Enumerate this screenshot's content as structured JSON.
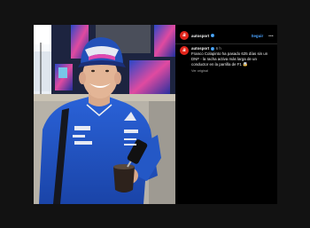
{
  "post": {
    "username": "autosport",
    "follow_label": "Seguir",
    "more_label": "•••",
    "avatar_letter": "a",
    "time_ago": "6 h",
    "caption": "Franco Colapinto ha pasado 625 días sin un DNF - la racha activa más larga de un conductor en la parrilla de F1",
    "caption_emoji": "🤯",
    "see_original": "Ver original"
  },
  "photo": {
    "cap_logo": "A",
    "team_mark": "A",
    "sponsor_1": "eni",
    "sponsor_2": "MSC",
    "sponsor_3": "Boeing"
  },
  "colors": {
    "accent": "#4aa3ff",
    "brand": "#e1251b",
    "team_blue": "#1f4fb5"
  }
}
